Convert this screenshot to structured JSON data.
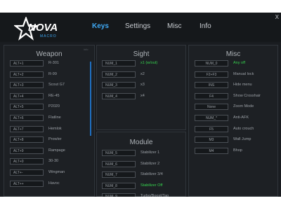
{
  "app": {
    "logo_text": "NOVA",
    "logo_sub": "MACRO",
    "close": "X",
    "tabs": [
      {
        "label": "Keys",
        "active": true
      },
      {
        "label": "Settings",
        "active": false
      },
      {
        "label": "Misc",
        "active": false
      },
      {
        "label": "Info",
        "active": false
      }
    ],
    "accent": "#3fa9f5",
    "status_on": "#36d14e"
  },
  "weapon": {
    "title": "Weapon",
    "tiny_label": "info",
    "rows": [
      {
        "key": "ALT+1",
        "label": "R-301"
      },
      {
        "key": "ALT+2",
        "label": "R-99"
      },
      {
        "key": "ALT+3",
        "label": "Scout G7"
      },
      {
        "key": "ALT+4",
        "label": "RE-45"
      },
      {
        "key": "ALT+5",
        "label": "P2020"
      },
      {
        "key": "ALT+6",
        "label": "Flatline"
      },
      {
        "key": "ALT+7",
        "label": "Hemlok"
      },
      {
        "key": "ALT+8",
        "label": "Prowler"
      },
      {
        "key": "ALT+9",
        "label": "Rampage"
      },
      {
        "key": "ALT+0",
        "label": "30-30"
      },
      {
        "key": "ALT+-",
        "label": "Wingman"
      },
      {
        "key": "ALT++",
        "label": "Havoc"
      }
    ]
  },
  "sight": {
    "title": "Sight",
    "rows": [
      {
        "key": "NUM_1",
        "label": "x1 (w/out)",
        "active": true
      },
      {
        "key": "NUM_2",
        "label": "x2",
        "active": false
      },
      {
        "key": "NUM_3",
        "label": "x3",
        "active": false
      },
      {
        "key": "NUM_4",
        "label": "x4",
        "active": false
      }
    ]
  },
  "module": {
    "title": "Module",
    "rows": [
      {
        "key": "NUM_5",
        "label": "Stabilizer 1",
        "active": false
      },
      {
        "key": "NUM_6",
        "label": "Stabilizer 2",
        "active": false
      },
      {
        "key": "NUM_7",
        "label": "Stabilizer 3/4",
        "active": false
      },
      {
        "key": "NUM_8",
        "label": "Stabilizer Off",
        "active": true
      },
      {
        "key": "NUM_9",
        "label": "Turbo/Boost/Tap",
        "active": false
      }
    ]
  },
  "misc": {
    "title": "Misc",
    "rows": [
      {
        "key": "NUM_0",
        "label": "Any off",
        "active": true
      },
      {
        "key": "F2+F3",
        "label": "Manual lock",
        "active": false
      },
      {
        "key": "INS",
        "label": "Hide menu",
        "active": false
      },
      {
        "key": "F4",
        "label": "Show Crosshair",
        "active": false
      },
      {
        "key": "None",
        "label": "Zoom Mode",
        "active": false
      },
      {
        "key": "NUM_*",
        "label": "Anti-AFK",
        "active": false
      },
      {
        "key": "F5",
        "label": "Auto crouch",
        "active": false
      },
      {
        "key": "M3",
        "label": "Wall Jump",
        "active": false
      },
      {
        "key": "M4",
        "label": "Bhop",
        "active": false
      }
    ]
  }
}
